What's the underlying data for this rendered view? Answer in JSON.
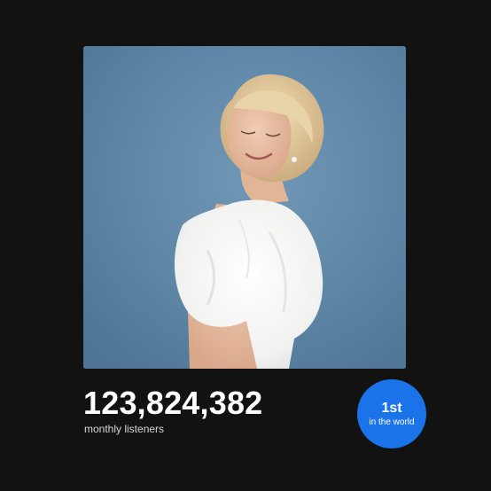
{
  "artist_photo": {
    "alt": "artist-portrait"
  },
  "stats": {
    "monthly_listeners": "123,824,382",
    "monthly_listeners_label": "monthly listeners"
  },
  "rank": {
    "value": "1st",
    "label": "in the world"
  },
  "colors": {
    "background": "#121212",
    "badge": "#1a73e8",
    "photo_backdrop": "#6189a8"
  }
}
